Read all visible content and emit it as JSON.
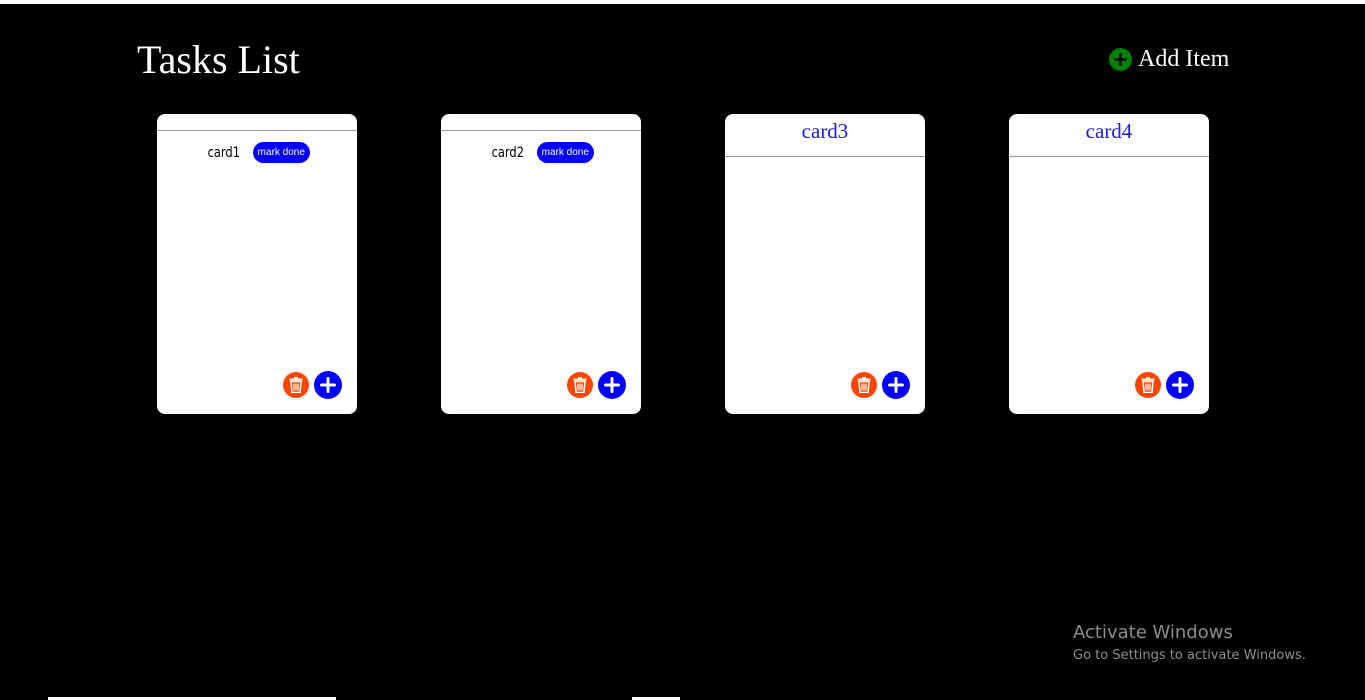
{
  "page": {
    "title": "Tasks List",
    "add_item_label": "Add Item"
  },
  "cards": [
    {
      "title": "",
      "tasks": [
        {
          "name": "card1",
          "action_label": "mark done"
        }
      ]
    },
    {
      "title": "",
      "tasks": [
        {
          "name": "card2",
          "action_label": "mark done"
        }
      ]
    },
    {
      "title": "card3",
      "tasks": []
    },
    {
      "title": "card4",
      "tasks": []
    }
  ],
  "icons": {
    "add_item": "plus-circle-icon",
    "delete": "trash-icon",
    "add": "plus-icon"
  },
  "colors": {
    "background": "#000000",
    "card": "#ffffff",
    "card_title": "#1a1ae6",
    "accent_blue": "#0000ff",
    "delete_orange": "#ff4500",
    "add_item_green": "#008000"
  },
  "watermark": {
    "title": "Activate Windows",
    "subtitle": "Go to Settings to activate Windows."
  }
}
